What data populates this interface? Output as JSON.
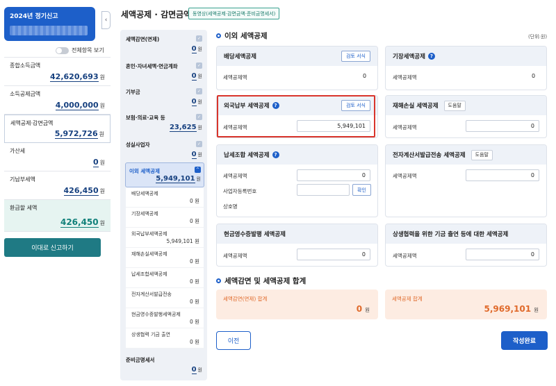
{
  "sidebar": {
    "year_title": "2024년 정기신고",
    "toggle_label": "전체항목 보기",
    "items": [
      {
        "label": "종합소득금액",
        "value": "42,620,693",
        "unit": "원"
      },
      {
        "label": "소득공제금액",
        "value": "4,000,000",
        "unit": "원"
      },
      {
        "label": "세액공제·감면금액",
        "value": "5,972,726",
        "unit": "원"
      },
      {
        "label": "가산세",
        "value": "0",
        "unit": "원"
      },
      {
        "label": "기납부세액",
        "value": "426,450",
        "unit": "원"
      },
      {
        "label": "환급할 세액",
        "value": "426,450",
        "unit": "원"
      }
    ],
    "file_button": "이대로 신고하기"
  },
  "header": {
    "title": "세액공제 · 감면금액",
    "video_tag": "동영상(세액공제·감면금액·준비금명세서)"
  },
  "midnav": {
    "items": [
      {
        "label": "세액감면(면제)",
        "value": "0",
        "unit": "원"
      },
      {
        "label": "혼인·자녀세액·연금계좌",
        "value": "0",
        "unit": "원"
      },
      {
        "label": "기부금",
        "value": "0",
        "unit": "원"
      },
      {
        "label": "보험·의료·교육 등",
        "value": "23,625",
        "unit": "원"
      },
      {
        "label": "성실사업자",
        "value": "0",
        "unit": "원"
      }
    ],
    "active": {
      "label": "이외 세액공제",
      "value": "5,949,101",
      "unit": "원"
    },
    "sub_items": [
      {
        "label": "배당세액공제",
        "value": "0 원"
      },
      {
        "label": "기장세액공제",
        "value": "0 원"
      },
      {
        "label": "외국납부세액공제",
        "value": "5,949,101 원"
      },
      {
        "label": "재해손실세액공제",
        "value": "0 원"
      },
      {
        "label": "납세조합세액공제",
        "value": "0 원"
      },
      {
        "label": "전자계산서발급전송",
        "value": "0 원"
      },
      {
        "label": "현금영수증발행세액공제",
        "value": "0 원"
      },
      {
        "label": "상생협력 기금 출연",
        "value": "0 원"
      }
    ],
    "last": {
      "label": "준비금명세서",
      "value": "0",
      "unit": "원"
    },
    "check_glyph": "✓",
    "expand_glyph": "^"
  },
  "main": {
    "section_title": "이외 세액공제",
    "unit_note": "(단위:원)",
    "info_glyph": "?",
    "review_label": "검토 서식",
    "help_label": "도움말",
    "row_label": "세액공제액",
    "cards": {
      "dividend": {
        "title": "배당세액공제",
        "value": "0"
      },
      "bookkeeping": {
        "title": "기장세액공제",
        "value": "0"
      },
      "foreign": {
        "title": "외국납부 세액공제",
        "value": "5,949,101"
      },
      "disaster": {
        "title": "재해손실 세액공제",
        "value": "0"
      },
      "union": {
        "title": "납세조합 세액공제",
        "value": "0",
        "biz_label": "사업자등록번호",
        "biz_value": "",
        "confirm": "확인",
        "name_label": "상호명"
      },
      "einvoice": {
        "title": "전자계산서발급전송 세액공제",
        "value": "0"
      },
      "cashreceipt": {
        "title": "현금영수증발행 세액공제",
        "value": "0"
      },
      "coop": {
        "title": "상생협력을 위한 기금 출연 등에 대한 세액공제",
        "value": "0"
      }
    },
    "total_section_title": "세액감면 및 세액공제 합계",
    "totals": {
      "reduction_label": "세액감면(면제) 합계",
      "reduction_value": "0",
      "credit_label": "세액공제 합계",
      "credit_value": "5,969,101",
      "unit": "원"
    },
    "prev_button": "이전",
    "done_button": "작성완료"
  },
  "colors": {
    "primary": "#1d5fc9",
    "teal": "#1f7a84",
    "highlight": "#d9342b",
    "orange": "#e06a2b"
  }
}
